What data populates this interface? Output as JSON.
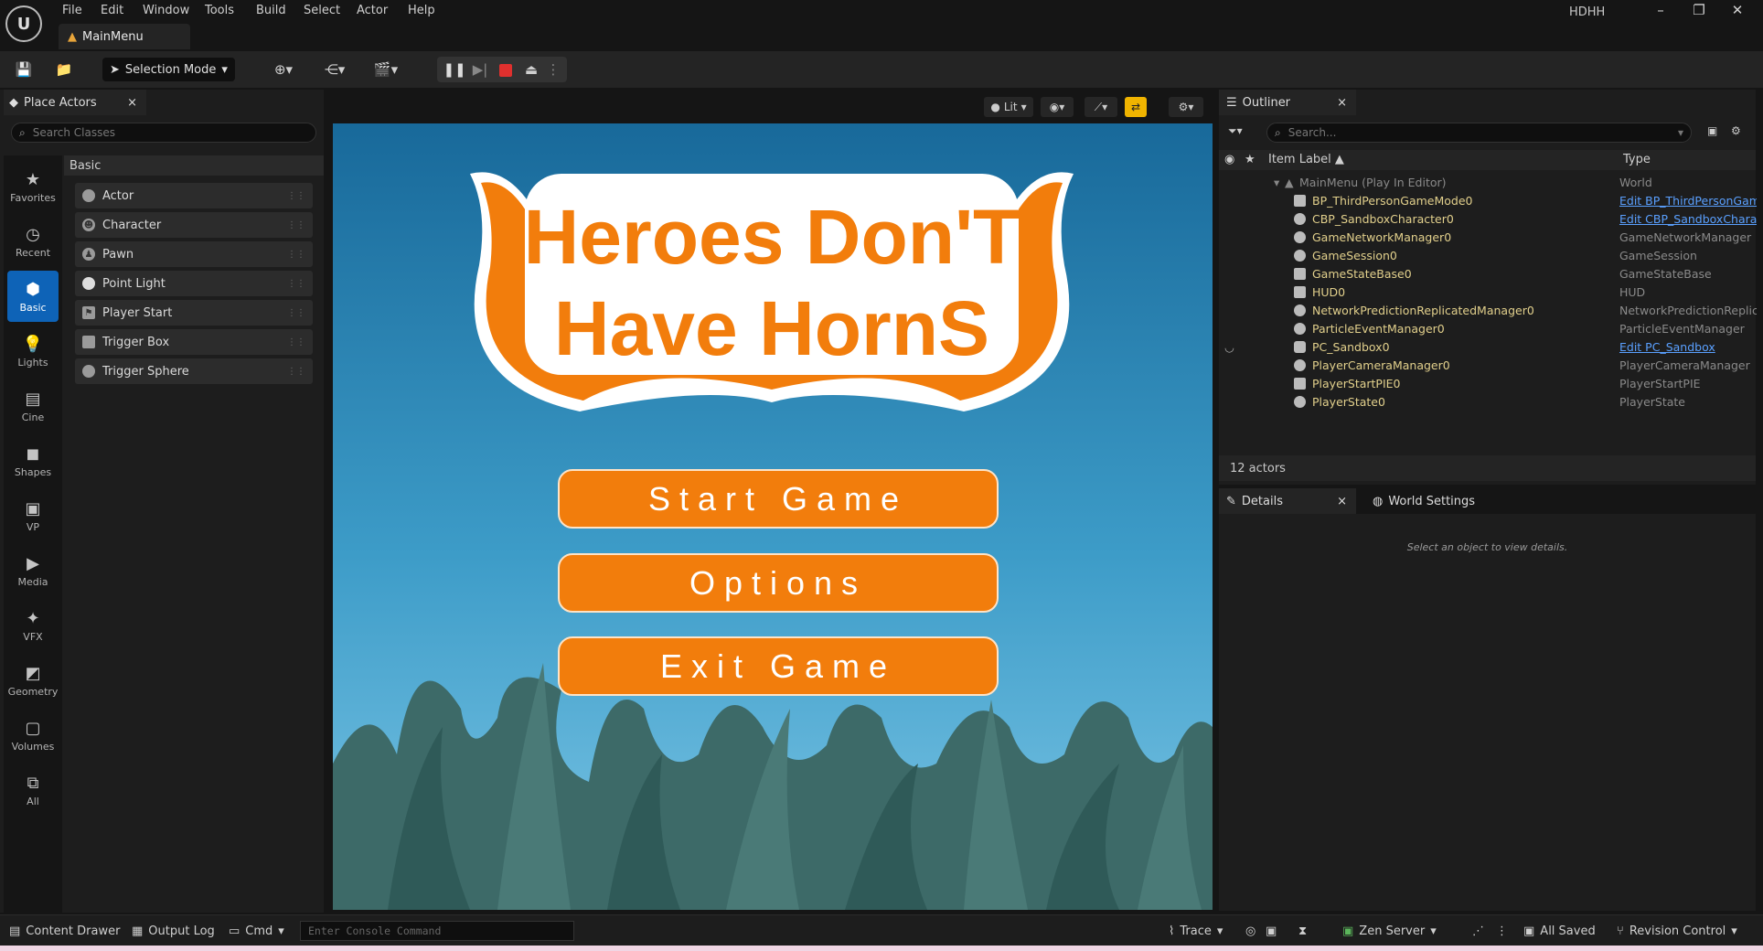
{
  "menu": [
    "File",
    "Edit",
    "Window",
    "Tools",
    "Build",
    "Select",
    "Actor",
    "Help"
  ],
  "document_tab": "MainMenu",
  "project_name": "HDHH",
  "toolbar": {
    "selection_mode": "Selection Mode"
  },
  "place_actors": {
    "tab_title": "Place Actors",
    "search_placeholder": "Search Classes",
    "categories": [
      "Favorites",
      "Recent",
      "Basic",
      "Lights",
      "Cine",
      "Shapes",
      "VP",
      "Media",
      "VFX",
      "Geometry",
      "Volumes",
      "All"
    ],
    "active_category": "Basic",
    "section_header": "Basic",
    "items": [
      "Actor",
      "Character",
      "Pawn",
      "Point Light",
      "Player Start",
      "Trigger Box",
      "Trigger Sphere"
    ]
  },
  "viewport": {
    "lit_label": "Lit",
    "game_title_line1": "Heroes Don'T",
    "game_title_line2": "Have HornS",
    "buttons": [
      "Start Game",
      "Options",
      "Exit Game"
    ]
  },
  "outliner": {
    "tab_title": "Outliner",
    "search_placeholder": "Search...",
    "col_label": "Item Label ▲",
    "col_type": "Type",
    "root": {
      "label": "MainMenu (Play In Editor)",
      "type": "World"
    },
    "rows": [
      {
        "label": "BP_ThirdPersonGameMode0",
        "type": "Edit BP_ThirdPersonGam"
      },
      {
        "label": "CBP_SandboxCharacter0",
        "type": "Edit CBP_SandboxCharac"
      },
      {
        "label": "GameNetworkManager0",
        "type": "GameNetworkManager"
      },
      {
        "label": "GameSession0",
        "type": "GameSession"
      },
      {
        "label": "GameStateBase0",
        "type": "GameStateBase"
      },
      {
        "label": "HUD0",
        "type": "HUD"
      },
      {
        "label": "NetworkPredictionReplicatedManager0",
        "type": "NetworkPredictionReplica"
      },
      {
        "label": "ParticleEventManager0",
        "type": "ParticleEventManager"
      },
      {
        "label": "PC_Sandbox0",
        "type": "Edit PC_Sandbox"
      },
      {
        "label": "PlayerCameraManager0",
        "type": "PlayerCameraManager"
      },
      {
        "label": "PlayerStartPIE0",
        "type": "PlayerStartPIE"
      },
      {
        "label": "PlayerState0",
        "type": "PlayerState"
      }
    ],
    "actor_count": "12 actors"
  },
  "details": {
    "tab_details": "Details",
    "tab_world_settings": "World Settings",
    "empty_message": "Select an object to view details."
  },
  "statusbar": {
    "content_drawer": "Content Drawer",
    "output_log": "Output Log",
    "cmd": "Cmd",
    "console_placeholder": "Enter Console Command",
    "trace": "Trace",
    "zen_server": "Zen Server",
    "all_saved": "All Saved",
    "revision_control": "Revision Control"
  },
  "colors": {
    "accent": "#0e63b7",
    "orange": "#f27d0c",
    "sky_top": "#1a6e9a",
    "sky_bottom": "#6fbde0"
  }
}
